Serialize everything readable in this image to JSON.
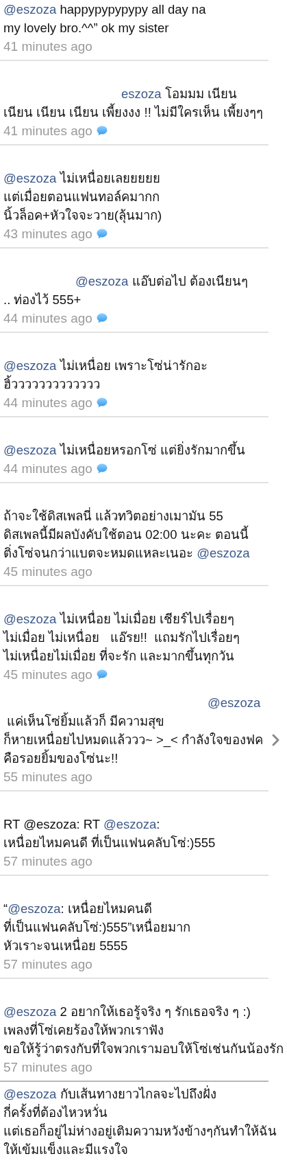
{
  "tweets": [
    {
      "lines": [
        [
          {
            "text": "@eszoza",
            "kind": "mention"
          },
          {
            "text": " happypypypypy all day na",
            "kind": "text"
          }
        ],
        [
          {
            "text": "my lovely bro.^^” ok my sister",
            "kind": "text"
          }
        ]
      ],
      "time": "41 minutes ago",
      "conversation": false,
      "disclosure": false
    },
    {
      "lines": [
        [
          {
            "text": "eszoza",
            "kind": "mention"
          },
          {
            "text": " โอมมม เนียน",
            "kind": "text"
          }
        ],
        [
          {
            "text": "เนียน เนียน เนียน เพี้ยงงง !! ไม่มีใครเห็น เพี้ยงๆๆ",
            "kind": "text"
          }
        ]
      ],
      "time": "41 minutes ago",
      "conversation": true,
      "disclosure": false
    },
    {
      "lines": [
        [
          {
            "text": "@eszoza",
            "kind": "mention"
          },
          {
            "text": " ไม่เหนื่อยเลยยยยย",
            "kind": "text"
          }
        ],
        [
          {
            "text": "แต่เมื่อยตอนแฟนทอล์คมากก",
            "kind": "text"
          }
        ],
        [
          {
            "text": "นิ้วล็อค+หัวใจจะวาย(ลุ้นมาก)",
            "kind": "text"
          }
        ]
      ],
      "time": "43 minutes ago",
      "conversation": true,
      "disclosure": false
    },
    {
      "lines": [
        [
          {
            "text": "@eszoza",
            "kind": "mention"
          },
          {
            "text": " แอ๊บต่อไป ต้องเนียนๆ",
            "kind": "text"
          }
        ],
        [
          {
            "text": ".. ท่องไว้ 555+",
            "kind": "text"
          }
        ]
      ],
      "time": "44 minutes ago",
      "conversation": true,
      "disclosure": false
    },
    {
      "lines": [
        [
          {
            "text": "@eszoza",
            "kind": "mention"
          },
          {
            "text": " ไม่เหนื่อย เพราะโซ่น่ารักอะ",
            "kind": "text"
          }
        ],
        [
          {
            "text": "ฮิ้ววววววววววววว",
            "kind": "text"
          }
        ]
      ],
      "time": "44 minutes ago",
      "conversation": true,
      "disclosure": false
    },
    {
      "lines": [
        [
          {
            "text": "@eszoza",
            "kind": "mention"
          },
          {
            "text": " ไม่เหนื่อยหรอกโซ่ แต่ยิ่งรักมากขึ้น",
            "kind": "text"
          }
        ]
      ],
      "time": "44 minutes ago",
      "conversation": true,
      "disclosure": false
    },
    {
      "lines": [
        [
          {
            "text": "ถ้าจะใช้ดิสเพลนี่ แล้วทวิตอย่างเมามัน 55",
            "kind": "text"
          }
        ],
        [
          {
            "text": "ดิสเพลนี้มีผลบังคับใช้ตอน 02:00 นะคะ ตอนนี้",
            "kind": "text"
          }
        ],
        [
          {
            "text": "ติ่งโซ่จนกว่าแบตจะหมดแหละเนอะ ",
            "kind": "text"
          },
          {
            "text": "@eszoza",
            "kind": "mention"
          }
        ]
      ],
      "time": "45 minutes ago",
      "conversation": false,
      "disclosure": false
    },
    {
      "lines": [
        [
          {
            "text": "@eszoza",
            "kind": "mention"
          },
          {
            "text": " ไม่เหนื่อย ไม่เมื่อย เชียร์ไปเรื่อยๆ",
            "kind": "text"
          }
        ],
        [
          {
            "text": "ไม่เมื่อย ไม่เหนื่อย   แอ๊รย!!  แถมรักไปเรื่อยๆ",
            "kind": "text"
          }
        ],
        [
          {
            "text": "ไม่เหนื่อยไม่เมื่อย ที่จะรัก และมากขึ้นทุกวัน",
            "kind": "text"
          }
        ]
      ],
      "time": "45 minutes ago",
      "conversation": true,
      "disclosure": false
    },
    {
      "lines": [
        [
          {
            "text": "@eszoza",
            "kind": "mention"
          }
        ],
        [
          {
            "text": " แค่เห็นโซ่ยิ้มแล้วก็ มีความสุข",
            "kind": "text"
          }
        ],
        [
          {
            "text": "ก็หายเหนื่อยไปหมดแล้ววว~ >_< กำลังใจของฟค",
            "kind": "text"
          }
        ],
        [
          {
            "text": "คือรอยยิ้มของโซ่นะ!!",
            "kind": "text"
          }
        ]
      ],
      "time": "55 minutes ago",
      "conversation": false,
      "disclosure": true
    },
    {
      "lines": [
        [
          {
            "text": "RT @eszoza: RT ",
            "kind": "text"
          },
          {
            "text": "@eszoza",
            "kind": "mention"
          },
          {
            "text": ":",
            "kind": "text"
          }
        ],
        [
          {
            "text": "เหนื่อยไหมคนดี ที่เป็นแฟนคลับโซ่:)555",
            "kind": "text"
          }
        ]
      ],
      "time": "57 minutes ago",
      "conversation": false,
      "disclosure": false
    },
    {
      "lines": [
        [
          {
            "text": "“",
            "kind": "text"
          },
          {
            "text": "@eszoza",
            "kind": "mention"
          },
          {
            "text": ": เหนื่อยไหมคนดี",
            "kind": "text"
          }
        ],
        [
          {
            "text": "ที่เป็นแฟนคลับโซ่:)555”เหนื่อยมาก",
            "kind": "text"
          }
        ],
        [
          {
            "text": "หัวเราะจนเหนื่อย 5555",
            "kind": "text"
          }
        ]
      ],
      "time": "57 minutes ago",
      "conversation": false,
      "disclosure": false
    },
    {
      "lines": [
        [
          {
            "text": "@eszoza",
            "kind": "mention"
          },
          {
            "text": " 2 อยากให้เธอรู้จริง ๆ รักเธอจริง ๆ :)",
            "kind": "text"
          }
        ],
        [
          {
            "text": "เพลงที่โซ่เคยร้องให้พวกเราฟัง",
            "kind": "text"
          }
        ],
        [
          {
            "text": "ขอให้รู้ว่าตรงกับที่ใจพวกเรามอบให้โซ่เช่นกันน้องรัก",
            "kind": "text"
          }
        ]
      ],
      "time": "57 minutes ago",
      "conversation": false,
      "disclosure": false
    },
    {
      "lines": [
        [
          {
            "text": "@eszoza",
            "kind": "mention"
          },
          {
            "text": " กับเส้นทางยาวไกลจะไปถึงฝั่ง",
            "kind": "text"
          }
        ],
        [
          {
            "text": "กี่ครั้งที่ต้องไหวหวั่น",
            "kind": "text"
          }
        ],
        [
          {
            "text": "แต่เธอก็อยู่ไม่ห่างอยู่เติมความหวังข้างๆกันทำให้ฉัน",
            "kind": "text"
          }
        ],
        [
          {
            "text": "ให้เข้มแข็งและมีแรงใจ",
            "kind": "text"
          }
        ]
      ],
      "conversation": false,
      "disclosure": false
    }
  ]
}
